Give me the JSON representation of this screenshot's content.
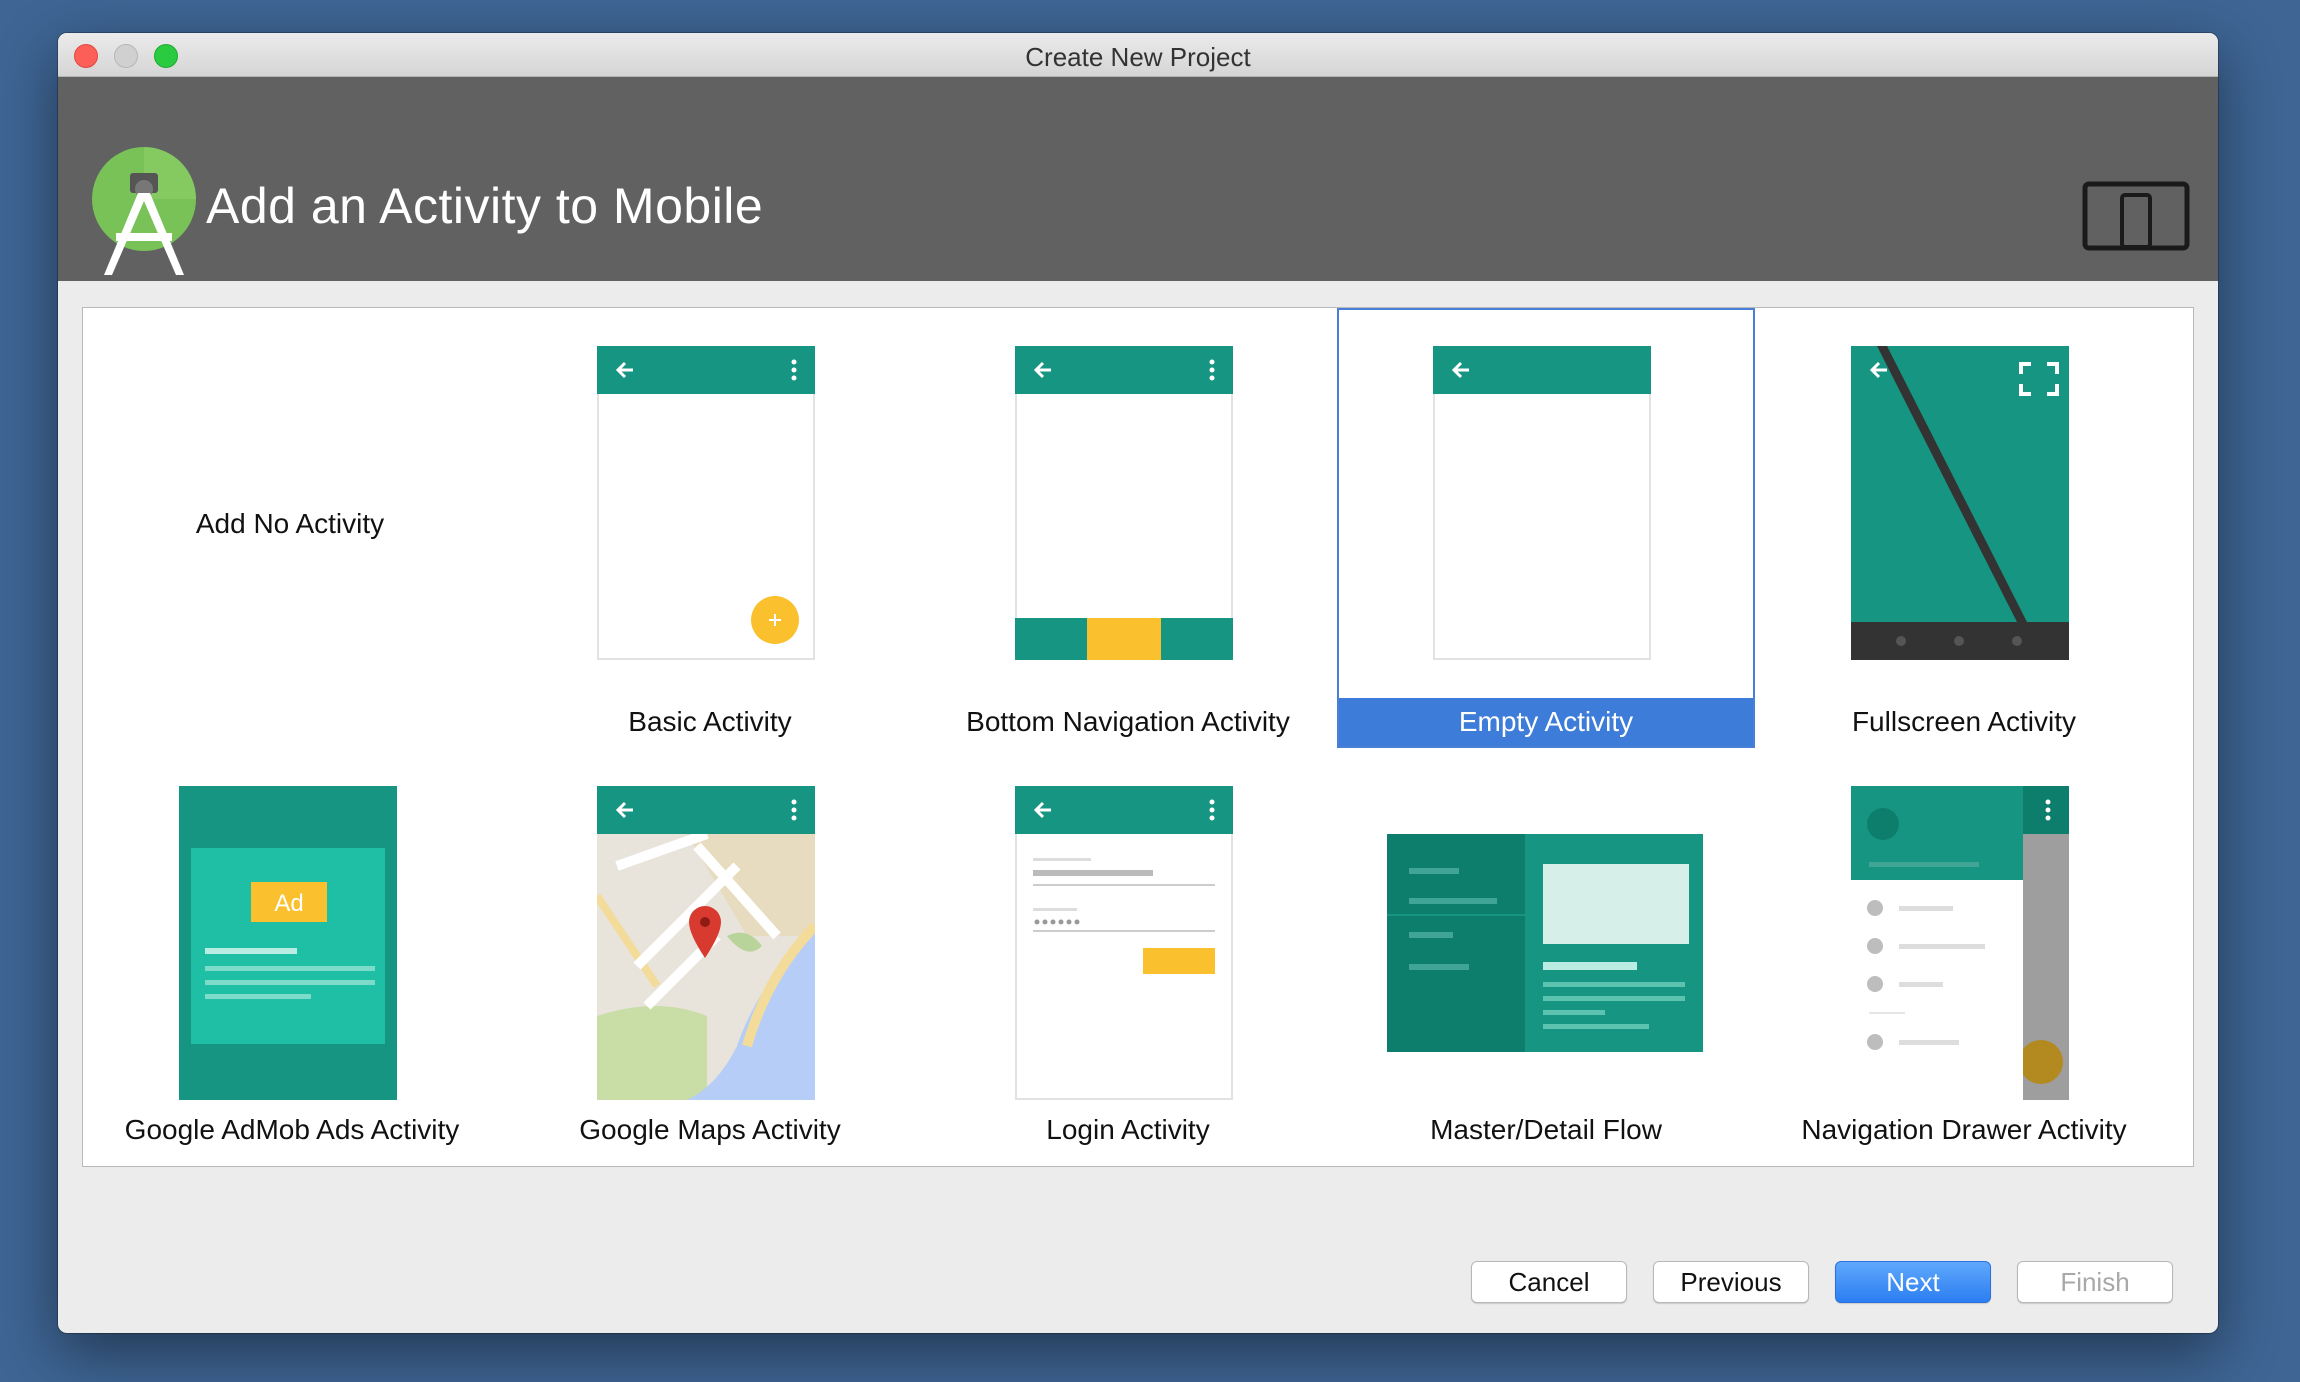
{
  "window": {
    "title": "Create New Project"
  },
  "header": {
    "title": "Add an Activity to Mobile"
  },
  "activities": [
    {
      "label": "Add No Activity"
    },
    {
      "label": "Basic Activity"
    },
    {
      "label": "Bottom Navigation Activity"
    },
    {
      "label": "Empty Activity"
    },
    {
      "label": "Fullscreen Activity"
    },
    {
      "label": "Google AdMob Ads Activity"
    },
    {
      "label": "Google Maps Activity"
    },
    {
      "label": "Login Activity"
    },
    {
      "label": "Master/Detail Flow"
    },
    {
      "label": "Navigation Drawer Activity"
    }
  ],
  "selected_activity": "Empty Activity",
  "ad_badge": "Ad",
  "buttons": {
    "cancel": "Cancel",
    "previous": "Previous",
    "next": "Next",
    "finish": "Finish"
  },
  "colors": {
    "teal": "#169682",
    "teal_dark": "#0e7e6c",
    "amber": "#fbc02d",
    "selection": "#3d7cd9",
    "header": "#616161"
  }
}
